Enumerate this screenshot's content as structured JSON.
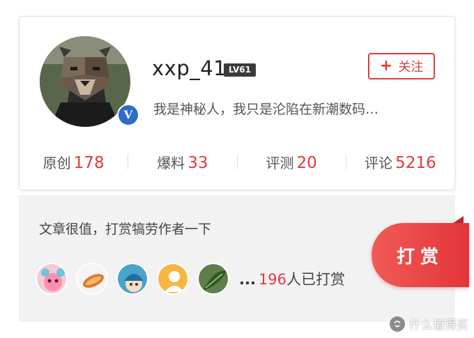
{
  "profile": {
    "username": "xxp_41",
    "level": "LV61",
    "verified_mark": "V",
    "follow_label": "关注",
    "follow_icon": "plus-icon",
    "bio": "我是神秘人，我只是沦陷在新潮数码…"
  },
  "stats": [
    {
      "label": "原创",
      "value": "178"
    },
    {
      "label": "爆料",
      "value": "33"
    },
    {
      "label": "评测",
      "value": "20"
    },
    {
      "label": "评论",
      "value": "5216"
    }
  ],
  "reward": {
    "prompt": "文章很值，打赏犒劳作者一下",
    "more": "...",
    "count": "196",
    "count_suffix": "人已打赏",
    "button_label": "打赏"
  },
  "watermark": {
    "text": "什么值得买"
  },
  "colors": {
    "accent": "#e4393c",
    "level_badge": "#3b3b3b",
    "verify": "#2d6cc9"
  }
}
